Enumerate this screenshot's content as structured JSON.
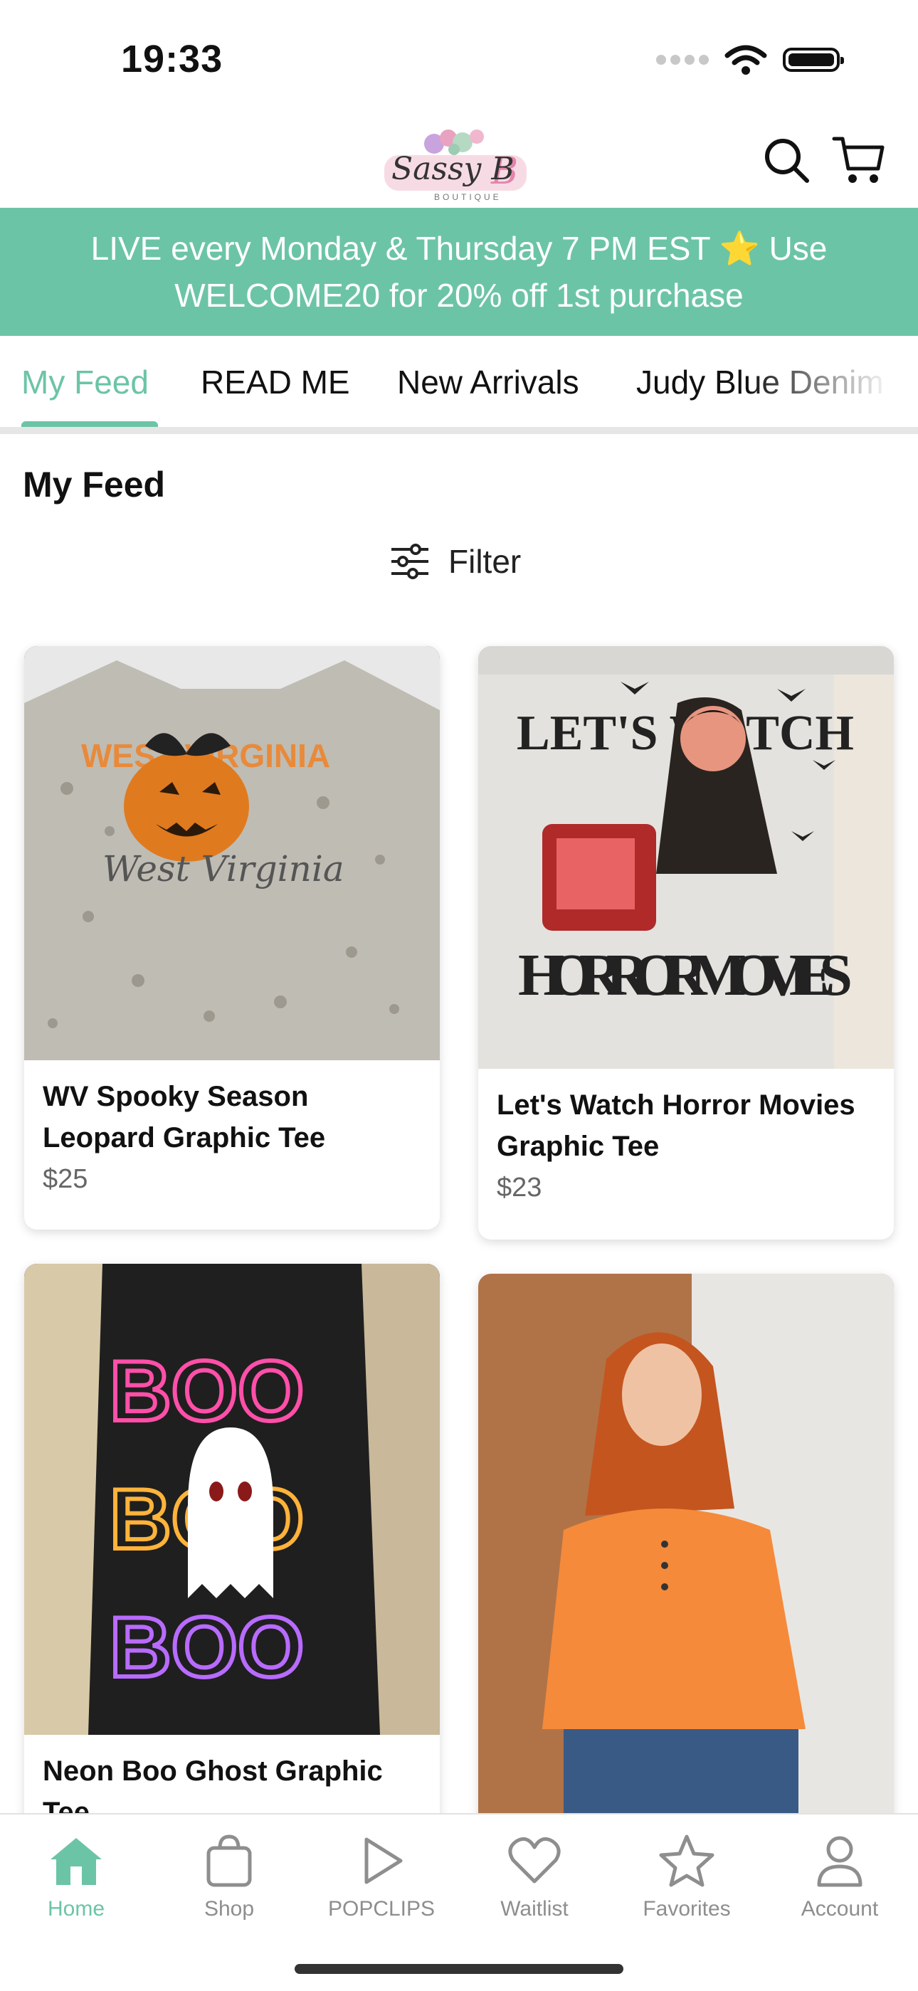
{
  "status_bar": {
    "time": "19:33"
  },
  "header": {
    "logo_text": "Sassy B",
    "logo_sub": "BOUTIQUE"
  },
  "banner": {
    "text": "LIVE every Monday & Thursday 7 PM EST ⭐ Use WELCOME20 for 20% off 1st purchase"
  },
  "tabs": [
    {
      "label": "My Feed",
      "active": true
    },
    {
      "label": "READ ME"
    },
    {
      "label": "New Arrivals"
    },
    {
      "label": "Judy Blue Denim"
    }
  ],
  "feed": {
    "title": "My Feed",
    "filter_label": "Filter"
  },
  "products": [
    {
      "name": "WV Spooky Season Leopard Graphic Tee",
      "price": "$25"
    },
    {
      "name": "Let's Watch Horror Movies Graphic Tee",
      "price": "$23"
    },
    {
      "name": "Neon Boo Ghost Graphic Tee",
      "price": ""
    },
    {
      "name": "",
      "price": ""
    }
  ],
  "artwork": {
    "wv_text": "WEST VIRGINIA",
    "wv_script": "West Virginia",
    "horror_top": "LET'S WATCH",
    "horror_bottom": "HORROR MOVIES",
    "boo": "BOO"
  },
  "tabbar": [
    {
      "label": "Home",
      "icon": "home-icon",
      "active": true
    },
    {
      "label": "Shop",
      "icon": "bag-icon"
    },
    {
      "label": "POPCLIPS",
      "icon": "play-icon"
    },
    {
      "label": "Waitlist",
      "icon": "heart-icon"
    },
    {
      "label": "Favorites",
      "icon": "star-icon"
    },
    {
      "label": "Account",
      "icon": "person-icon"
    }
  ],
  "colors": {
    "accent": "#6cc4a6",
    "banner": "#6cc4a6",
    "inactive": "#8e8e8e"
  }
}
